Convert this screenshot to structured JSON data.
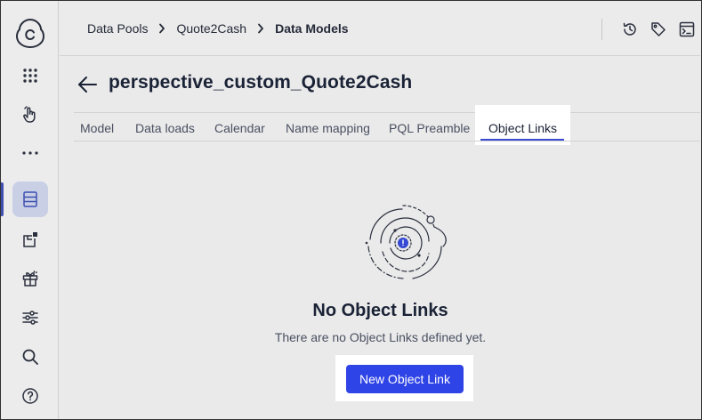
{
  "colors": {
    "accent": "#2f44e6",
    "tab_underline": "#3a4ad2",
    "nav_active_bg": "#c9d0e6",
    "text_primary": "#1a2236",
    "text_secondary": "#4a5061"
  },
  "sidebar": {
    "items": [
      {
        "icon": "brand-logo-icon",
        "active": false
      },
      {
        "icon": "apps-grid-icon",
        "active": false
      },
      {
        "icon": "hand-pointer-icon",
        "active": false
      },
      {
        "icon": "more-horizontal-icon",
        "active": false
      },
      {
        "icon": "data-icon",
        "active": true
      },
      {
        "icon": "studio-icon",
        "active": false
      },
      {
        "icon": "marketplace-icon",
        "active": false
      },
      {
        "icon": "settings-sliders-icon",
        "active": false
      },
      {
        "icon": "search-icon",
        "active": false
      },
      {
        "icon": "help-icon",
        "active": false
      }
    ]
  },
  "header": {
    "breadcrumbs": [
      "Data Pools",
      "Quote2Cash",
      "Data Models"
    ],
    "icons": [
      "history-icon",
      "tag-icon",
      "terminal-icon"
    ]
  },
  "page": {
    "title": "perspective_custom_Quote2Cash"
  },
  "tabs": [
    {
      "label": "Model",
      "active": false
    },
    {
      "label": "Data loads",
      "active": false
    },
    {
      "label": "Calendar",
      "active": false
    },
    {
      "label": "Name mapping",
      "active": false
    },
    {
      "label": "PQL Preamble",
      "active": false
    },
    {
      "label": "Object Links",
      "active": true
    }
  ],
  "empty_state": {
    "icon": "empty-orbit-illustration",
    "title": "No Object Links",
    "description": "There are no Object Links defined yet.",
    "button_label": "New Object Link"
  }
}
